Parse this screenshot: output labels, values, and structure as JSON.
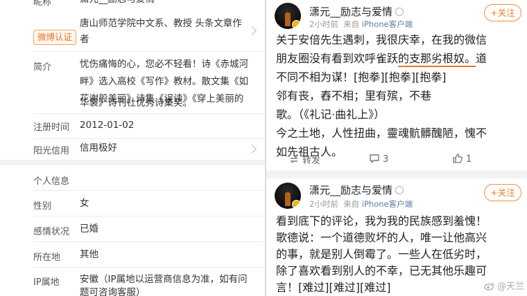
{
  "profile": {
    "nickname_label": "昵称",
    "nickname_value": "潇元__励志与爱情",
    "verified_badge": "微博认证",
    "verified_value_1": "唐山师范学院中文系、教授 头条文章作",
    "verified_value_2": "者",
    "intro_label": "简介",
    "intro_lines": [
      "忧伤痛悔的心，您必不轻看！诗《赤城河",
      "畔》选入高校《写作》教材。散文集《如",
      "花谢般美丽》诗集《误读》《穿上美丽的",
      "华裳》诗刊社优秀诗集奖。"
    ],
    "reg_label": "注册时间",
    "reg_value": "2012-01-02",
    "credit_label": "阳光信用",
    "credit_value": "信用极好",
    "personal_header": "个人信息",
    "gender_label": "性别",
    "gender_value": "女",
    "relationship_label": "感情状况",
    "relationship_value": "已婚",
    "location_label": "所在地",
    "location_value": "其他",
    "ip_label": "IP属地",
    "ip_value_1": "安徽（IP属地以运营商信息为准，如有问",
    "ip_value_2": "题可咨询客服）"
  },
  "posts": [
    {
      "username": "潇元__励志与爱情",
      "time": "2小时前",
      "source_prefix": "来自",
      "source": "iPhone客户端",
      "follow_label": "+关注",
      "lines": [
        {
          "pre": "关于安倍先生遇刺，我很庆幸，在我的微信",
          "ul": "",
          "post": ""
        },
        {
          "pre": "朋友圈没有看到欢呼雀跃",
          "ul": "的支那劣根奴。",
          "post": "道"
        },
        {
          "pre": "不同不相为谋！[抱拳][抱拳][抱拳]",
          "ul": "",
          "post": ""
        },
        {
          "pre": "邻有丧，舂不相；里有殡，不巷",
          "ul": "",
          "post": ""
        },
        {
          "pre": "歌。（《礼记·曲礼上》）",
          "ul": "",
          "post": ""
        },
        {
          "pre": "今之土地，人性扭曲，靈魂骯髒醜陋，愧不",
          "ul": "",
          "post": ""
        },
        {
          "pre": "如先祖古人。",
          "ul": "",
          "post": ""
        }
      ],
      "actions": {
        "repost": "转发",
        "comments": "3",
        "likes": "1"
      }
    },
    {
      "username": "潇元__励志与爱情",
      "time": "2小时前",
      "source_prefix": "来自",
      "source": "iPhone客户端",
      "follow_label": "+关注",
      "lines": [
        "看到底下的评论，我为我的民族感到羞愧！",
        "歌德说：一个道德败坏的人，唯一让他高兴",
        "的事，就是别人倒霉了。一些人在低劣时，",
        "除了喜欢看到别人的不幸，已无其他乐趣可",
        "言！[难过][难过][难过]"
      ]
    }
  ],
  "watermark": "@天兰",
  "colors": {
    "accent": "#e8731c",
    "link": "#5a7fa6",
    "separator": "#f2f2f2"
  }
}
